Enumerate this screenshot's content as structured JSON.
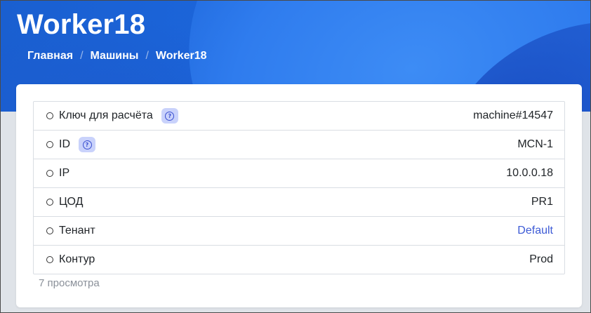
{
  "page": {
    "title": "Worker18"
  },
  "breadcrumb": [
    {
      "label": "Главная"
    },
    {
      "label": "Машины"
    },
    {
      "label": "Worker18"
    }
  ],
  "properties": [
    {
      "label": "Ключ для расчёта",
      "value": "machine#14547",
      "has_help": true
    },
    {
      "label": "ID",
      "value": "MCN-1",
      "has_help": true
    },
    {
      "label": "IP",
      "value": "10.0.0.18",
      "has_help": false
    },
    {
      "label": "ЦОД",
      "value": "PR1",
      "has_help": false
    },
    {
      "label": "Тенант",
      "value": "Default",
      "has_help": false,
      "is_link": true
    },
    {
      "label": "Контур",
      "value": "Prod",
      "has_help": false
    }
  ],
  "footer": {
    "views": "7 просмотра"
  },
  "icons": {
    "help": "question-circle-icon",
    "radio": "radio-circle-icon"
  },
  "colors": {
    "header_blue": "#1c66dc",
    "link": "#3d5bd6",
    "help_badge": "#c9d2fb"
  }
}
